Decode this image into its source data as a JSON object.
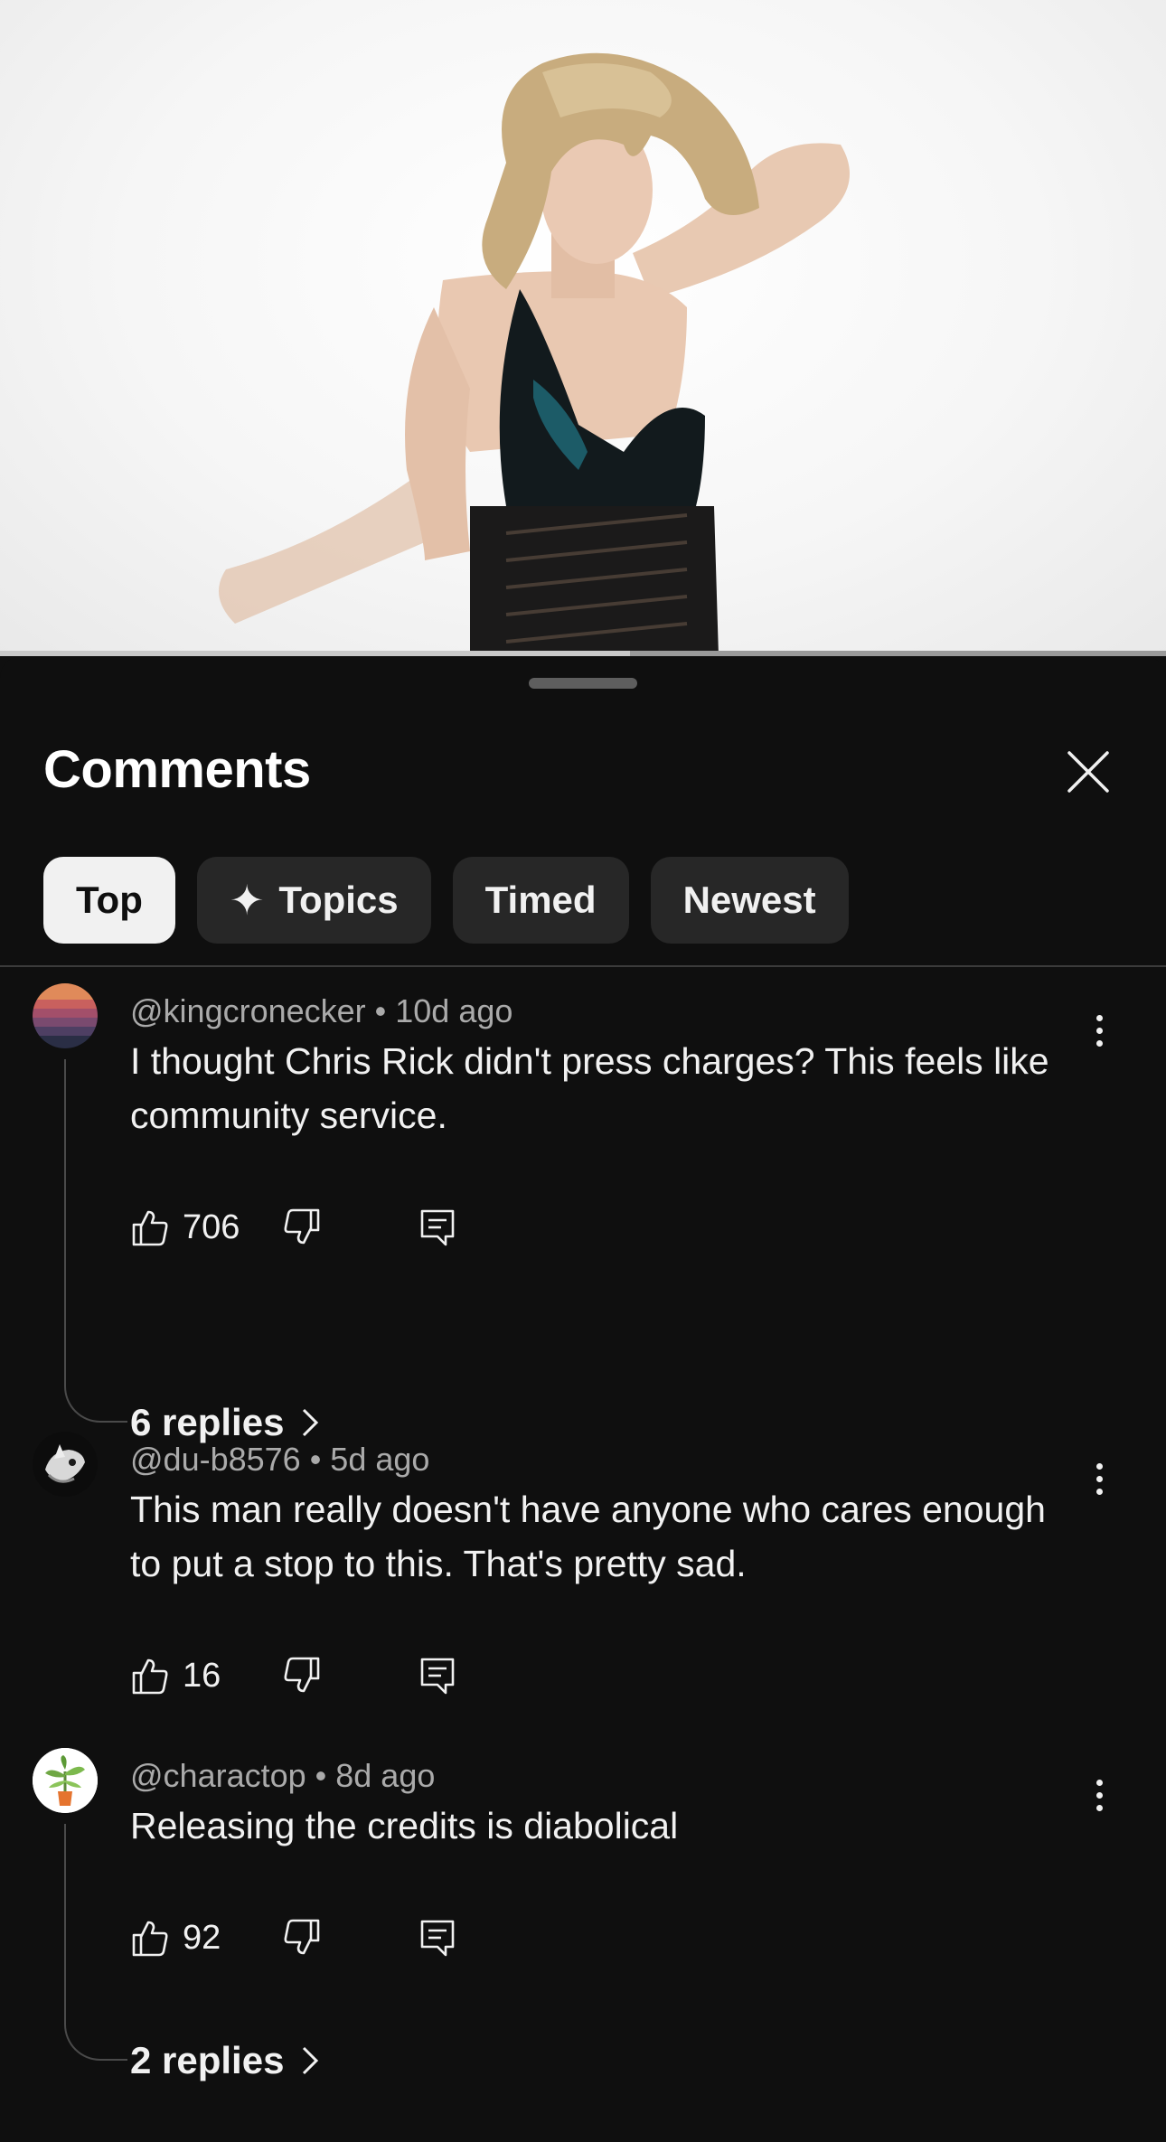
{
  "video": {
    "progress": 0.54
  },
  "sheet": {
    "title": "Comments"
  },
  "chips": [
    {
      "label": "Top",
      "active": true
    },
    {
      "label": "Topics",
      "icon": "sparkle-icon"
    },
    {
      "label": "Timed"
    },
    {
      "label": "Newest"
    }
  ],
  "comments": [
    {
      "author": "@kingcronecker",
      "time": "10d ago",
      "text": "I thought Chris Rick didn't press charges? This feels like community service.",
      "likes": "706",
      "replies": "6 replies"
    },
    {
      "author": "@du-b8576",
      "time": "5d ago",
      "text": "This man really doesn't have anyone who cares enough to put a stop to this.  That's pretty sad.",
      "likes": "16"
    },
    {
      "author": "@charactop",
      "time": "8d ago",
      "text": "Releasing the credits is diabolical",
      "likes": "92",
      "replies": "2 replies"
    }
  ],
  "colors": {
    "background": "#0f0f0f",
    "chip_bg": "#272727",
    "chip_active_bg": "#f1f1f1",
    "meta_text": "#aaaaaa"
  }
}
